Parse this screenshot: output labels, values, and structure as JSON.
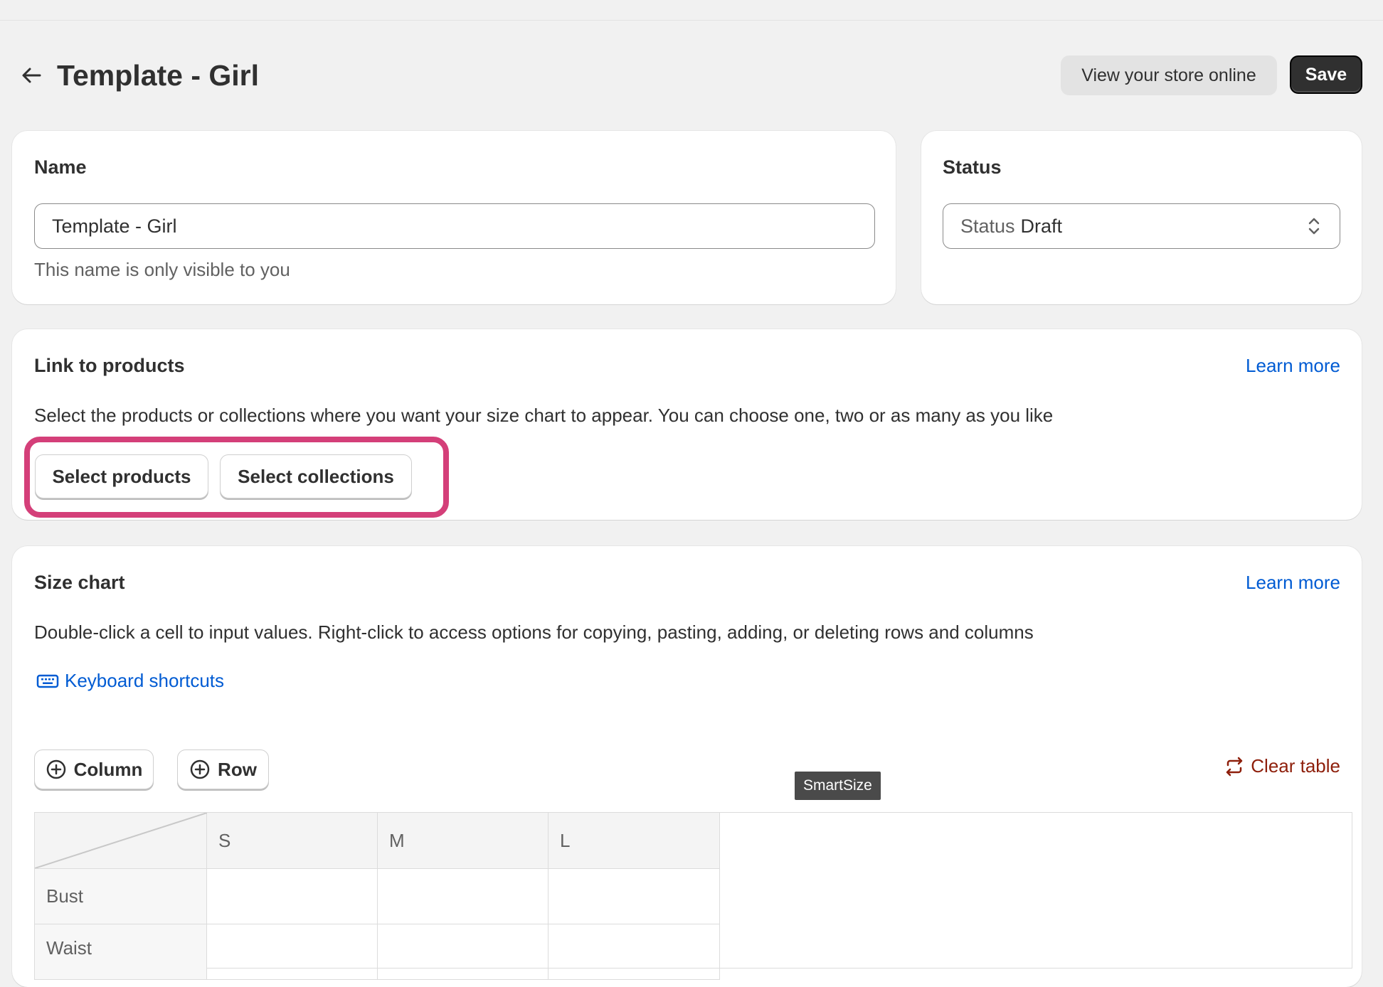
{
  "header": {
    "title": "Template - Girl",
    "view_store_label": "View your store online",
    "save_label": "Save"
  },
  "name_card": {
    "title": "Name",
    "input_value": "Template - Girl",
    "help_text": "This name is only visible to you"
  },
  "status_card": {
    "title": "Status",
    "select_label": "Status",
    "select_value": "Draft"
  },
  "link_card": {
    "title": "Link to products",
    "learn_more": "Learn more",
    "description": "Select the products or collections where you want your size chart to appear. You can choose one, two or as many as you like",
    "select_products_label": "Select products",
    "select_collections_label": "Select collections",
    "highlight_color": "#d43f79"
  },
  "size_chart_card": {
    "title": "Size chart",
    "learn_more": "Learn more",
    "description": "Double-click a cell to input values. Right-click to access options for copying, pasting, adding, or deleting rows and columns",
    "keyboard_shortcuts": "Keyboard shortcuts",
    "add_column_label": "Column",
    "add_row_label": "Row",
    "tooltip": "SmartSize",
    "clear_table_label": "Clear table",
    "table": {
      "columns": [
        "S",
        "M",
        "L"
      ],
      "rows": [
        "Bust",
        "Waist"
      ]
    }
  },
  "icons": {
    "back": "arrow-left-icon",
    "select": "chevron-up-down-icon",
    "keyboard": "keyboard-icon",
    "add": "plus-circle-icon",
    "clear": "refresh-arrows-icon"
  },
  "colors": {
    "link": "#005bd3",
    "danger": "#8e1f0b",
    "primary_button": "#303030",
    "background": "#f1f1f1"
  }
}
